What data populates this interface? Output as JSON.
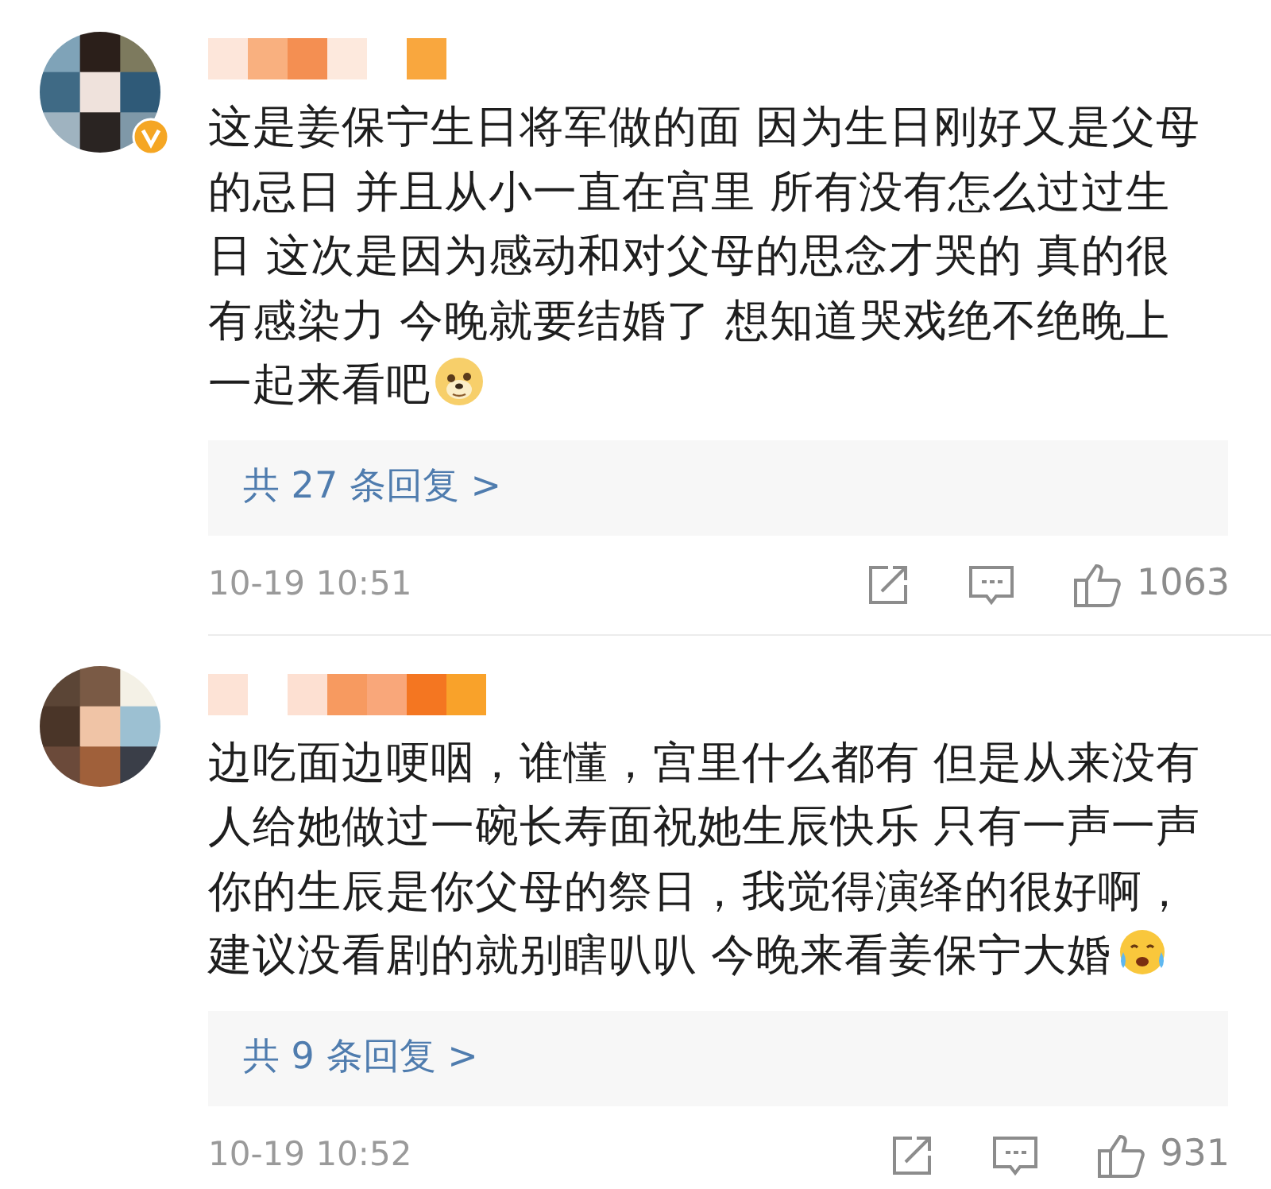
{
  "comments": [
    {
      "verified": true,
      "kind": "dog",
      "lines": [
        "这是姜保宁生日将军做的面 因为生日刚好又是父母",
        "的忌日 并且从小一直在宫里 所有没有怎么过过生",
        "日 这次是因为感动和对父母的思念才哭的 真的很",
        "有感染力 今晚就要结婚了 想知道哭戏绝不绝晚上",
        "一起来看吧"
      ],
      "replies": "共 27 条回复 >",
      "time": "10-19 10:51",
      "likes": "1063"
    },
    {
      "verified": false,
      "kind": "crying",
      "lines": [
        "边吃面边哽咽，谁懂，宫里什么都有 但是从来没有",
        "人给她做过一碗长寿面祝她生辰快乐 只有一声一声",
        "你的生辰是你父母的祭日，我觉得演绎的很好啊，",
        "建议没看剧的就别瞎叭叭 今晚来看姜保宁大婚"
      ],
      "replies": "共 9 条回复 >",
      "time": "10-19 10:52",
      "likes": "931"
    }
  ]
}
